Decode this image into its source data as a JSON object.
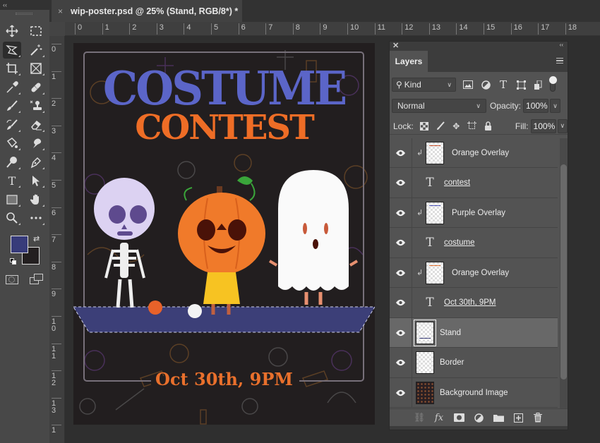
{
  "app": {
    "document_tab": {
      "title": "wip-poster.psd @ 25% (Stand, RGB/8*) *",
      "close_glyph": "×"
    },
    "collapse_glyph": "‹‹"
  },
  "toolbar": {
    "tools": [
      {
        "name": "move-tool",
        "icon": "move-icon",
        "active": false
      },
      {
        "name": "rectangular-marquee-tool",
        "icon": "marquee-icon",
        "active": false
      },
      {
        "name": "polygonal-lasso-tool",
        "icon": "lasso-icon",
        "active": true
      },
      {
        "name": "magic-wand-tool",
        "icon": "magic-wand-icon",
        "active": false
      },
      {
        "name": "crop-tool",
        "icon": "crop-icon",
        "active": false
      },
      {
        "name": "frame-tool",
        "icon": "frame-icon",
        "active": false
      },
      {
        "name": "eyedropper-tool",
        "icon": "eyedropper-icon",
        "active": false
      },
      {
        "name": "healing-brush-tool",
        "icon": "bandage-icon",
        "active": false
      },
      {
        "name": "brush-tool",
        "icon": "brush-icon",
        "active": false
      },
      {
        "name": "clone-stamp-tool",
        "icon": "stamp-icon",
        "active": false
      },
      {
        "name": "history-brush-tool",
        "icon": "history-brush-icon",
        "active": false
      },
      {
        "name": "eraser-tool",
        "icon": "eraser-icon",
        "active": false
      },
      {
        "name": "paint-bucket-tool",
        "icon": "bucket-icon",
        "active": false
      },
      {
        "name": "smudge-tool",
        "icon": "smudge-icon",
        "active": false
      },
      {
        "name": "dodge-tool",
        "icon": "dodge-icon",
        "active": false
      },
      {
        "name": "pen-tool",
        "icon": "pen-icon",
        "active": false
      },
      {
        "name": "type-tool",
        "icon": "type-icon",
        "active": false
      },
      {
        "name": "path-selection-tool",
        "icon": "arrow-icon",
        "active": false
      },
      {
        "name": "rectangle-tool",
        "icon": "rectangle-icon",
        "active": false
      },
      {
        "name": "hand-tool",
        "icon": "hand-icon",
        "active": false
      },
      {
        "name": "zoom-tool",
        "icon": "magnifier-icon",
        "active": false
      },
      {
        "name": "edit-toolbar",
        "icon": "more-icon",
        "active": false
      }
    ],
    "foreground_color": "#373b7a",
    "background_color": "#231f20"
  },
  "rulers": {
    "horizontal": [
      "0",
      "1",
      "2",
      "3",
      "4",
      "5",
      "6",
      "7",
      "8",
      "9",
      "10",
      "11",
      "12",
      "13",
      "14",
      "15",
      "16",
      "17",
      "18"
    ],
    "vertical": [
      "0",
      "1",
      "2",
      "3",
      "4",
      "5",
      "6",
      "7",
      "8",
      "9",
      "10",
      "11",
      "12",
      "13",
      "1"
    ]
  },
  "poster": {
    "title_line1": "COSTUME",
    "title_line2": "CONTEST",
    "date_line": "Oct 30th, 9PM",
    "colors": {
      "background": "#221e1f",
      "purple": "#5b65c8",
      "orange": "#ee6d26",
      "stand": "#3c3f78"
    }
  },
  "layers_panel": {
    "tab_label": "Layers",
    "filter": {
      "label": "Kind",
      "chevron": "⌄"
    },
    "blend_mode": "Normal",
    "opacity_label": "Opacity:",
    "opacity_value": "100%",
    "lock_label": "Lock:",
    "fill_label": "Fill:",
    "fill_value": "100%",
    "layers": [
      {
        "name": "Orange Overlay",
        "type": "clipped-image",
        "thumb_line": "#c8502a",
        "visible": true,
        "selected": false
      },
      {
        "name": "contest",
        "type": "text",
        "visible": true,
        "selected": false
      },
      {
        "name": "Purple Overlay",
        "type": "clipped-image",
        "thumb_line": "#4a52b8",
        "visible": true,
        "selected": false
      },
      {
        "name": "costume",
        "type": "text",
        "visible": true,
        "selected": false
      },
      {
        "name": "Orange Overlay",
        "type": "clipped-image",
        "thumb_line": "#e07030",
        "visible": true,
        "selected": false
      },
      {
        "name": "Oct 30th, 9PM",
        "type": "text",
        "visible": true,
        "selected": false
      },
      {
        "name": "Stand",
        "type": "image",
        "thumb_line": "#3c3f78",
        "visible": true,
        "selected": true
      },
      {
        "name": "Border",
        "type": "image",
        "visible": true,
        "selected": false
      },
      {
        "name": "Background Image",
        "type": "image-dark",
        "visible": true,
        "selected": false
      }
    ],
    "text_glyph": "T",
    "clip_glyph": "↲",
    "bottom_buttons": [
      "link-layers",
      "fx",
      "add-mask",
      "adjustment-layer",
      "new-group",
      "new-layer",
      "delete-layer"
    ],
    "fx_label": "fx"
  }
}
